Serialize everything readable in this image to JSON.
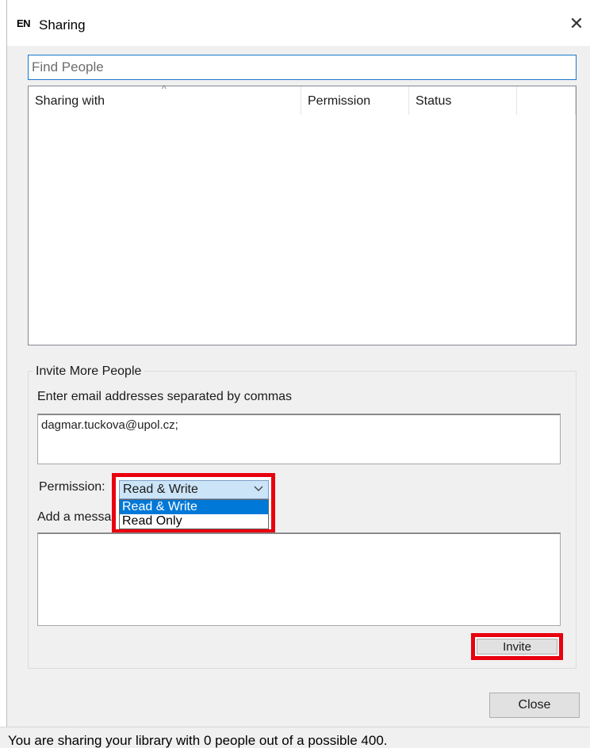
{
  "window": {
    "app_icon": "EN",
    "title": "Sharing",
    "close_glyph": "✕"
  },
  "search": {
    "placeholder": "Find People",
    "value": ""
  },
  "list": {
    "columns": [
      "Sharing with",
      "Permission",
      "Status",
      ""
    ],
    "sort_glyph": "^",
    "rows": []
  },
  "invite": {
    "group_label": "Invite More People",
    "email_label": "Enter email addresses separated by commas",
    "email_value": "dagmar.tuckova@upol.cz;",
    "permission_label": "Permission:",
    "permission_selected": "Read & Write",
    "permission_options": [
      "Read & Write",
      "Read Only"
    ],
    "message_label": "Add a messa",
    "message_value": "",
    "invite_label": "Invite"
  },
  "footer": {
    "close_label": "Close"
  },
  "status": {
    "text": "You are sharing your library with 0 people out of a possible 400."
  },
  "colors": {
    "highlight": "#e8000e",
    "selection": "#0078d7",
    "focus_border": "#1979ca"
  }
}
